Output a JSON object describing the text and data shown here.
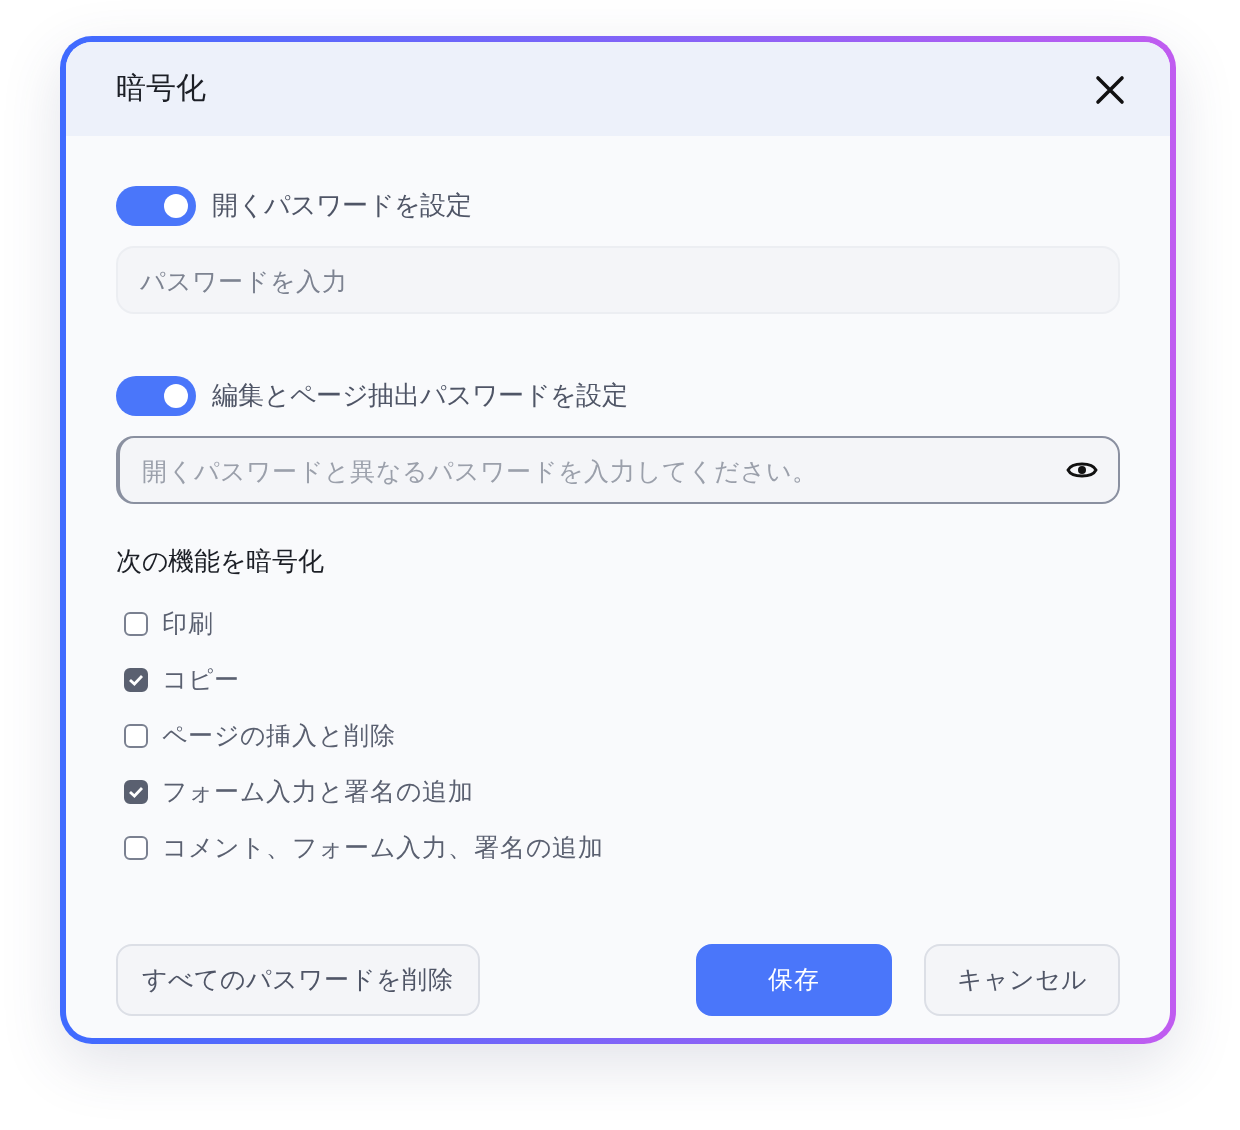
{
  "dialog": {
    "title": "暗号化"
  },
  "sections": [
    {
      "toggle": {
        "label": "開くパスワードを設定",
        "on": true
      },
      "field": {
        "placeholder": "パスワードを入力",
        "focused": false,
        "reveal_icon": false
      }
    },
    {
      "toggle": {
        "label": "編集とページ抽出パスワードを設定",
        "on": true
      },
      "field": {
        "placeholder": "開くパスワードと異なるパスワードを入力してください。",
        "focused": true,
        "reveal_icon": true
      }
    }
  ],
  "permissions": {
    "title": "次の機能を暗号化",
    "items": [
      {
        "label": "印刷",
        "checked": false
      },
      {
        "label": "コピー",
        "checked": true
      },
      {
        "label": "ページの挿入と削除",
        "checked": false
      },
      {
        "label": "フォーム入力と署名の追加",
        "checked": true
      },
      {
        "label": "コメント、フォーム入力、署名の追加",
        "checked": false
      }
    ]
  },
  "buttons": [
    {
      "label": "すべてのパスワードを削除",
      "kind": "secondary"
    },
    {
      "label": "保存",
      "kind": "primary"
    },
    {
      "label": "キャンセル",
      "kind": "secondary"
    }
  ]
}
